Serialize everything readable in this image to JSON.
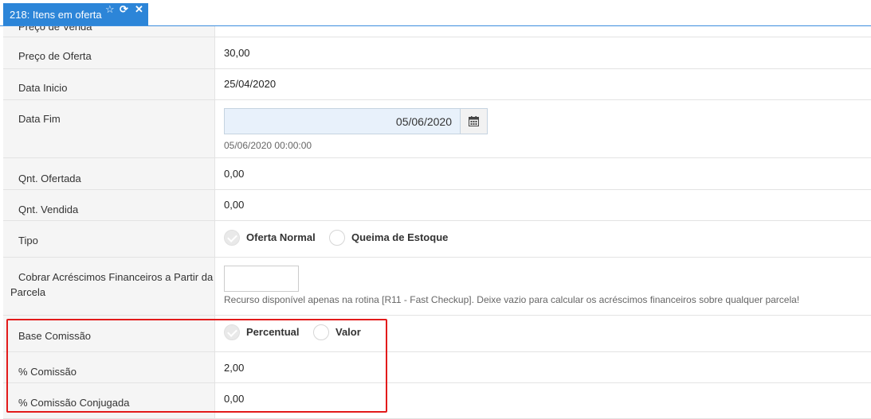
{
  "tab": {
    "title": "218: Itens em oferta",
    "star_icon": "☆",
    "refresh_icon": "⟳",
    "close_icon": "✕"
  },
  "fields": {
    "preco_venda": {
      "label": "Preço de Venda"
    },
    "preco_oferta": {
      "label": "Preço de Oferta",
      "value": "30,00"
    },
    "data_inicio": {
      "label": "Data Inicio",
      "value": "25/04/2020"
    },
    "data_fim": {
      "label": "Data Fim",
      "value": "05/06/2020",
      "hint": "05/06/2020 00:00:00"
    },
    "qnt_ofertada": {
      "label": "Qnt. Ofertada",
      "value": "0,00"
    },
    "qnt_vendida": {
      "label": "Qnt. Vendida",
      "value": "0,00"
    },
    "tipo": {
      "label": "Tipo",
      "options": [
        "Oferta Normal",
        "Queima de Estoque"
      ],
      "selected": "Oferta Normal"
    },
    "acrescimos": {
      "label_line1": "Cobrar Acréscimos Financeiros a Partir da",
      "label_line2": "Parcela",
      "value": "",
      "hint": "Recurso disponível apenas na rotina [R11 - Fast Checkup]. Deixe vazio para calcular os acréscimos financeiros sobre qualquer parcela!"
    },
    "base_comissao": {
      "label": "Base Comissão",
      "options": [
        "Percentual",
        "Valor"
      ],
      "selected": "Percentual"
    },
    "comissao": {
      "label": "% Comissão",
      "value": "2,00"
    },
    "comissao_conjugada": {
      "label": "% Comissão Conjugada",
      "value": "0,00"
    }
  },
  "colors": {
    "tab_bg": "#2c85d8",
    "highlight": "#e31b1b",
    "date_bg": "#e8f1fb"
  }
}
